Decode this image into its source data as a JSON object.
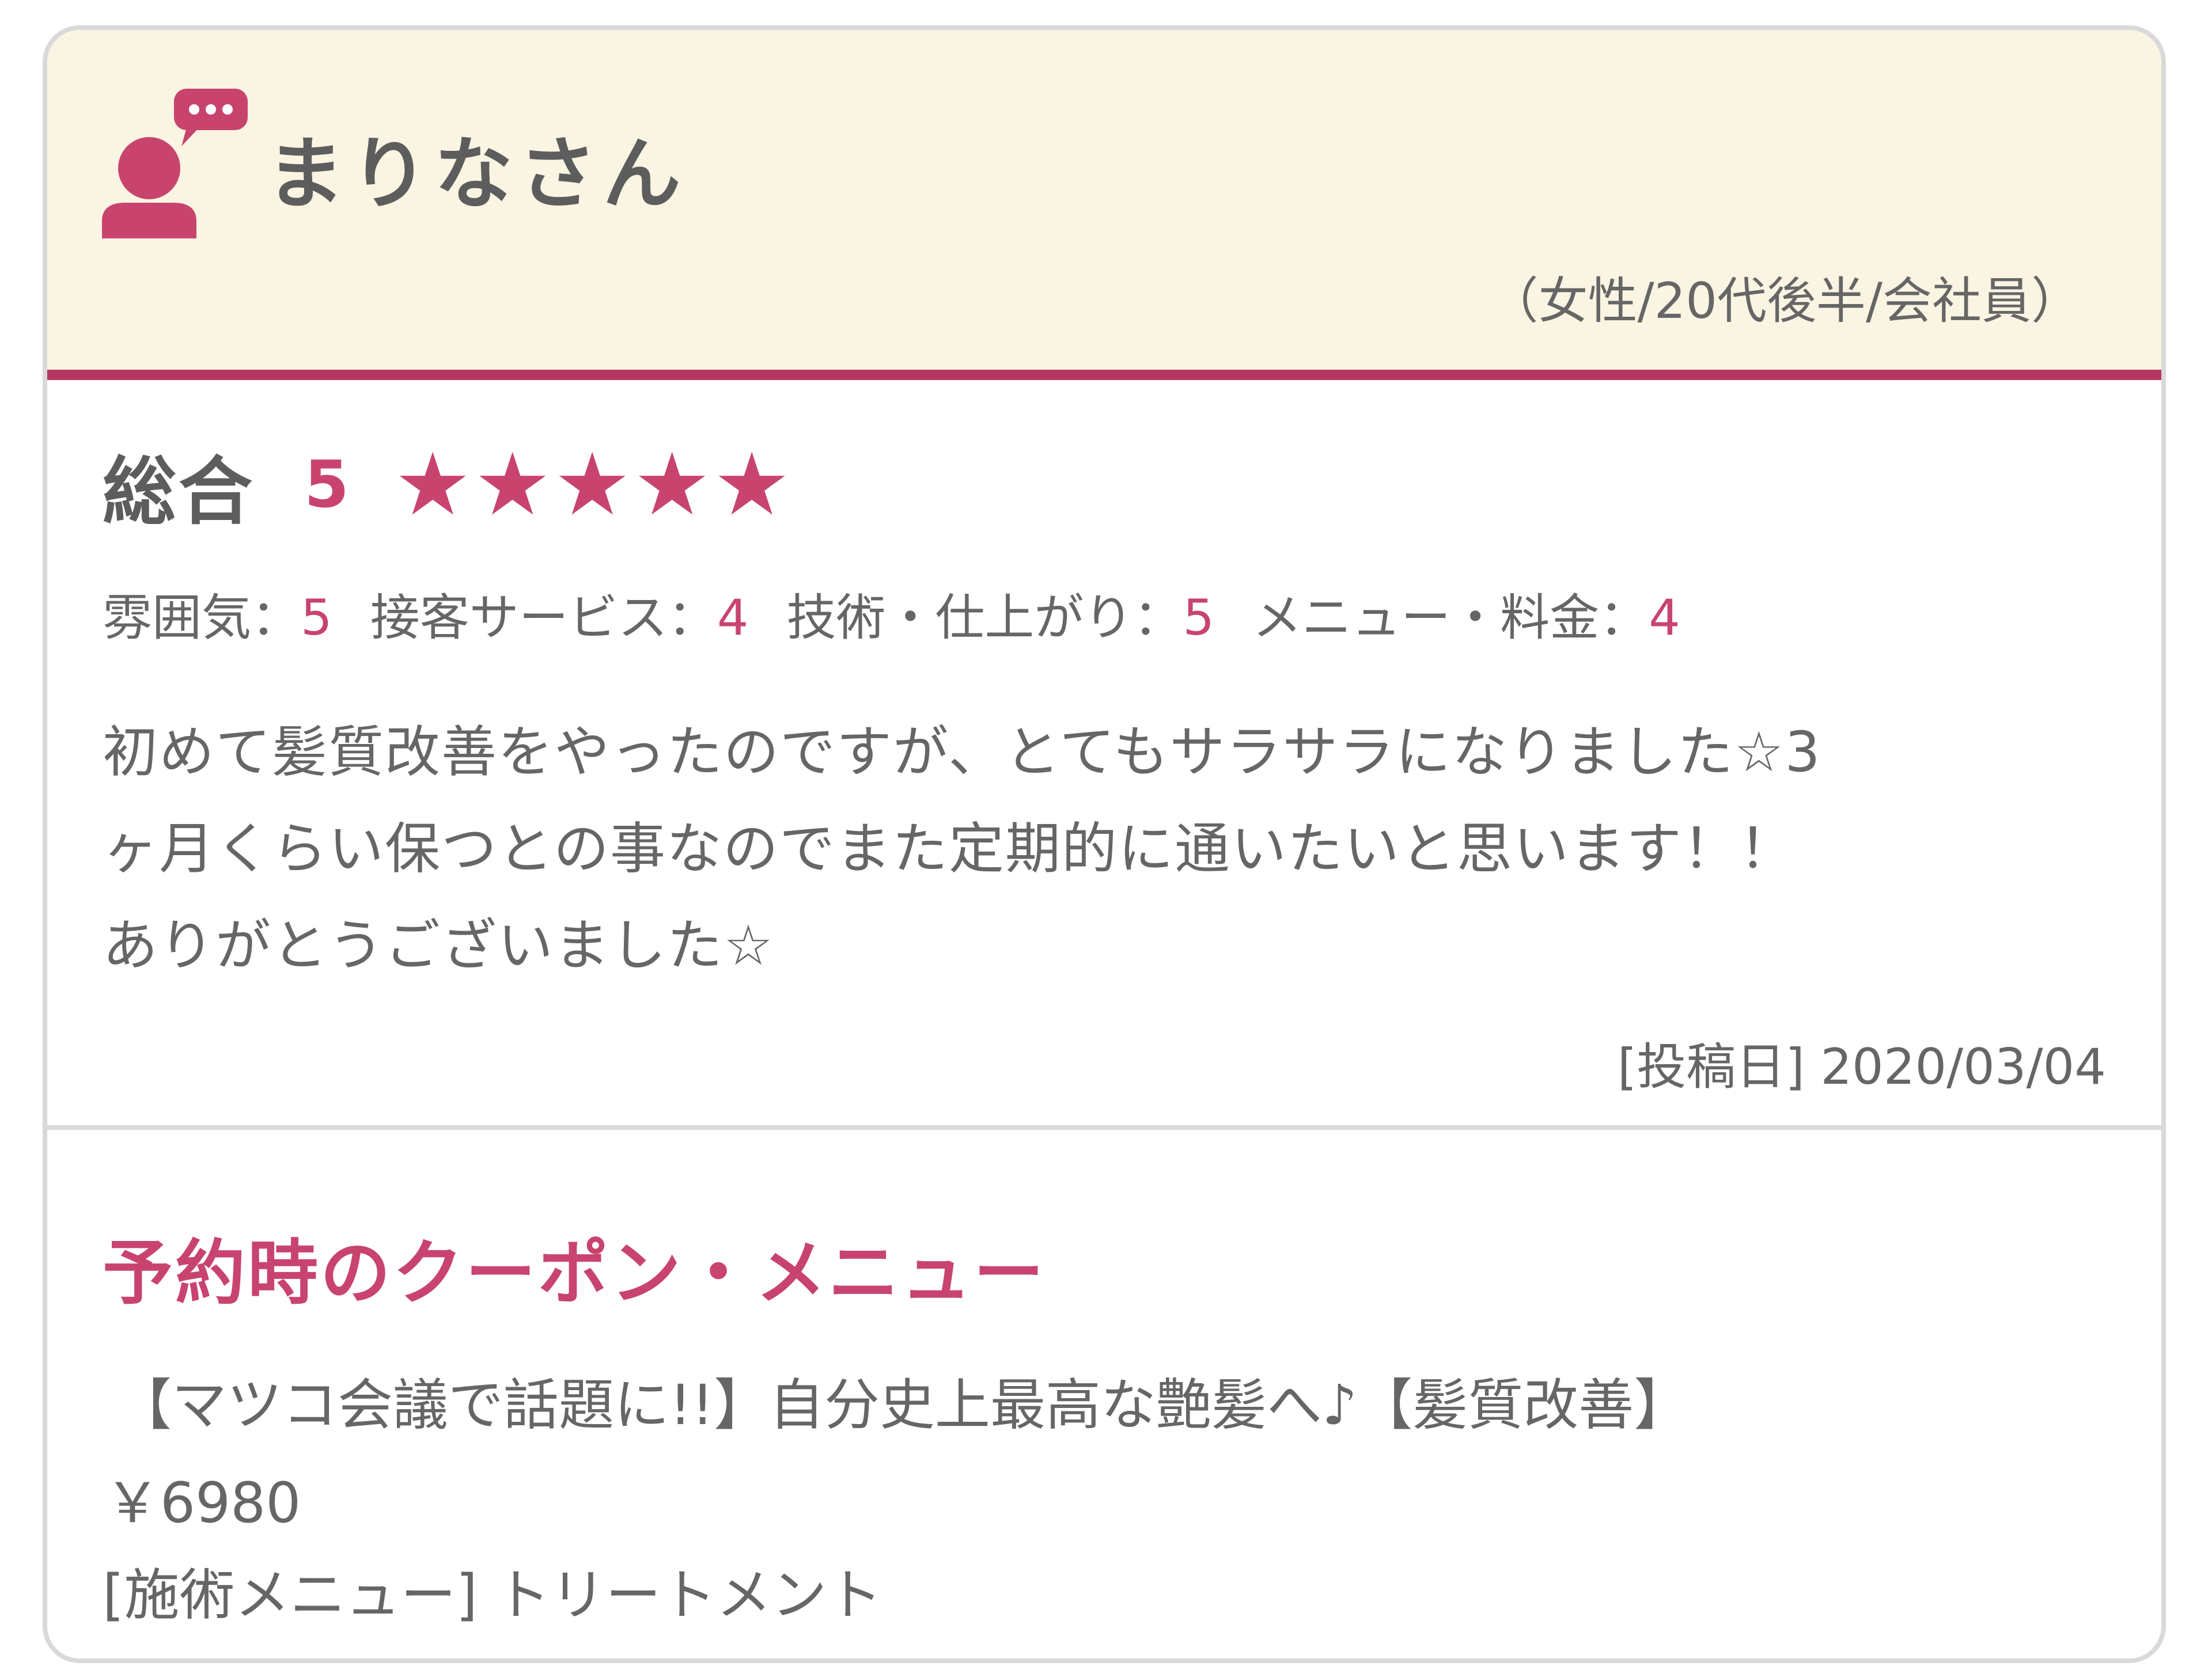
{
  "reviewer": {
    "name": "まりなさん",
    "profile": "（女性/20代後半/会社員）"
  },
  "rating": {
    "overall_label": "総合",
    "overall_score": "5",
    "stars_filled": 5,
    "stars_total": 5,
    "star_glyph": "★",
    "items": [
      {
        "label": "雰囲気：",
        "value": "5"
      },
      {
        "label": "接客サービス：",
        "value": "4"
      },
      {
        "label": "技術・仕上がり：",
        "value": "5"
      },
      {
        "label": "メニュー・料金：",
        "value": "4"
      }
    ]
  },
  "review": {
    "lines": [
      "初めて髪質改善をやったのですが、とてもサラサラになりました☆3",
      "ヶ月くらい保つとの事なのでまた定期的に通いたいと思います！！",
      "ありがとうございました☆"
    ],
    "post_date": "[投稿日] 2020/03/04"
  },
  "coupon": {
    "title": "予約時のクーポン・メニュー",
    "name": "【マツコ会議で話題に!!】自分史上最高な艶髪へ♪【髪質改善】",
    "price": "￥6980",
    "treatment_menu": "[施術メニュー] トリートメント"
  },
  "colors": {
    "accent": "#c8446e",
    "header_bg": "#faf4e3",
    "header_border": "#b5365e",
    "text": "#666666",
    "card_border": "#d9d9d9"
  }
}
